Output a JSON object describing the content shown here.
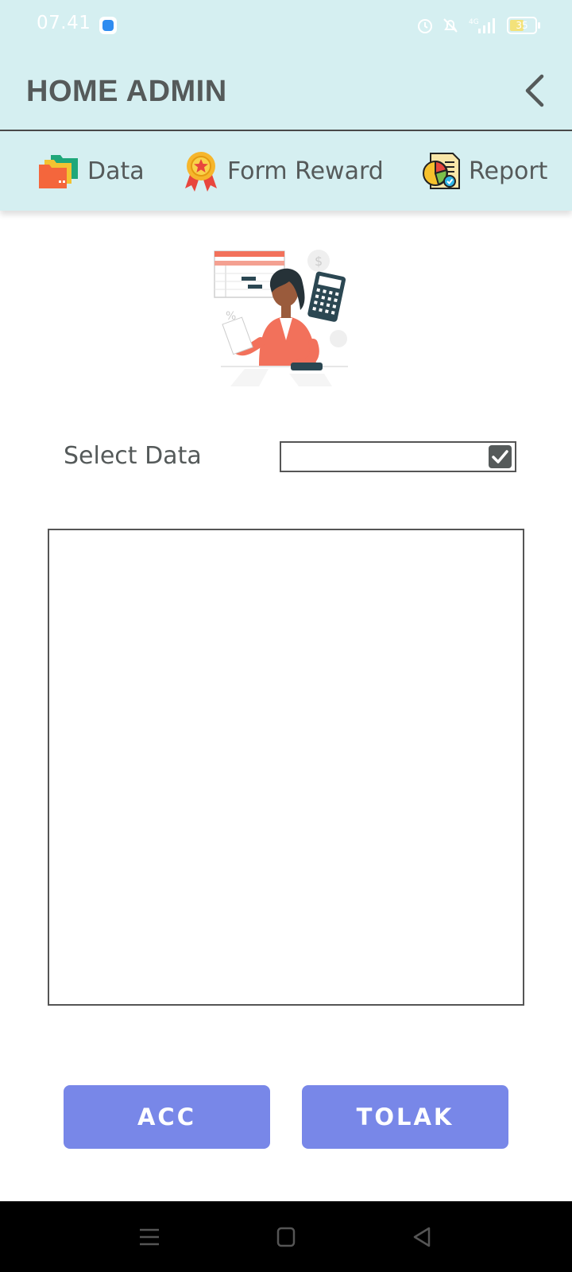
{
  "status_bar": {
    "time": "07.41",
    "battery_level": "35",
    "network": "4G",
    "icons": [
      "app-notification-icon",
      "alarm-icon",
      "silent-bell-icon",
      "signal-icon",
      "battery-icon"
    ]
  },
  "header": {
    "title": "HOME ADMIN",
    "back_icon": "chevron-left-icon",
    "background": "#d5eff1"
  },
  "menu": {
    "items": [
      {
        "label": "Data",
        "icon": "folders-icon"
      },
      {
        "label": "Form Reward",
        "icon": "medal-icon"
      },
      {
        "label": "Report",
        "icon": "report-chart-icon"
      }
    ]
  },
  "illustration": {
    "icon": "accountant-illustration"
  },
  "select": {
    "label": "Select Data",
    "value": "",
    "checked": true
  },
  "actions": {
    "acc_label": "ACC",
    "tolak_label": "TOLAK",
    "button_color": "#7887e8"
  },
  "nav_bar": {
    "icons": [
      "menu-icon",
      "home-icon",
      "back-triangle-icon"
    ]
  }
}
